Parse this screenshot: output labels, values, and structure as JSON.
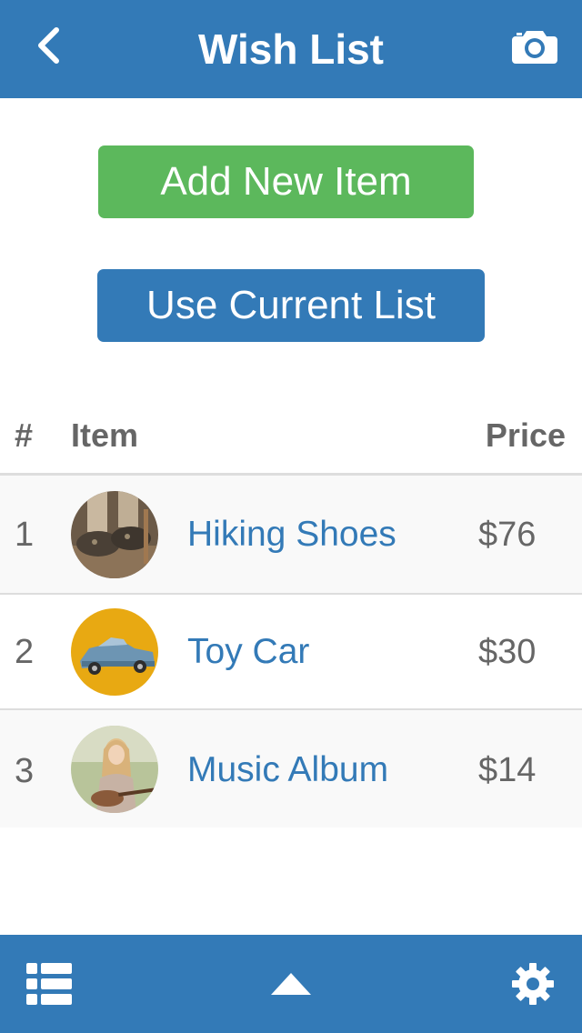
{
  "colors": {
    "primary": "#337ab7",
    "success": "#5cb85c",
    "link": "#337ab7",
    "muted": "#666666"
  },
  "header": {
    "title": "Wish List",
    "back_icon": "chevron-left-icon",
    "right_icon": "camera-icon"
  },
  "actions": {
    "add_label": "Add New Item",
    "use_label": "Use Current List"
  },
  "table": {
    "headers": {
      "num": "#",
      "item": "Item",
      "price": "Price"
    },
    "rows": [
      {
        "num": "1",
        "name": "Hiking Shoes",
        "price": "$76"
      },
      {
        "num": "2",
        "name": "Toy Car",
        "price": "$30"
      },
      {
        "num": "3",
        "name": "Music Album",
        "price": "$14"
      }
    ]
  },
  "footer": {
    "left_icon": "list-icon",
    "center_icon": "caret-up-icon",
    "right_icon": "gear-icon"
  }
}
